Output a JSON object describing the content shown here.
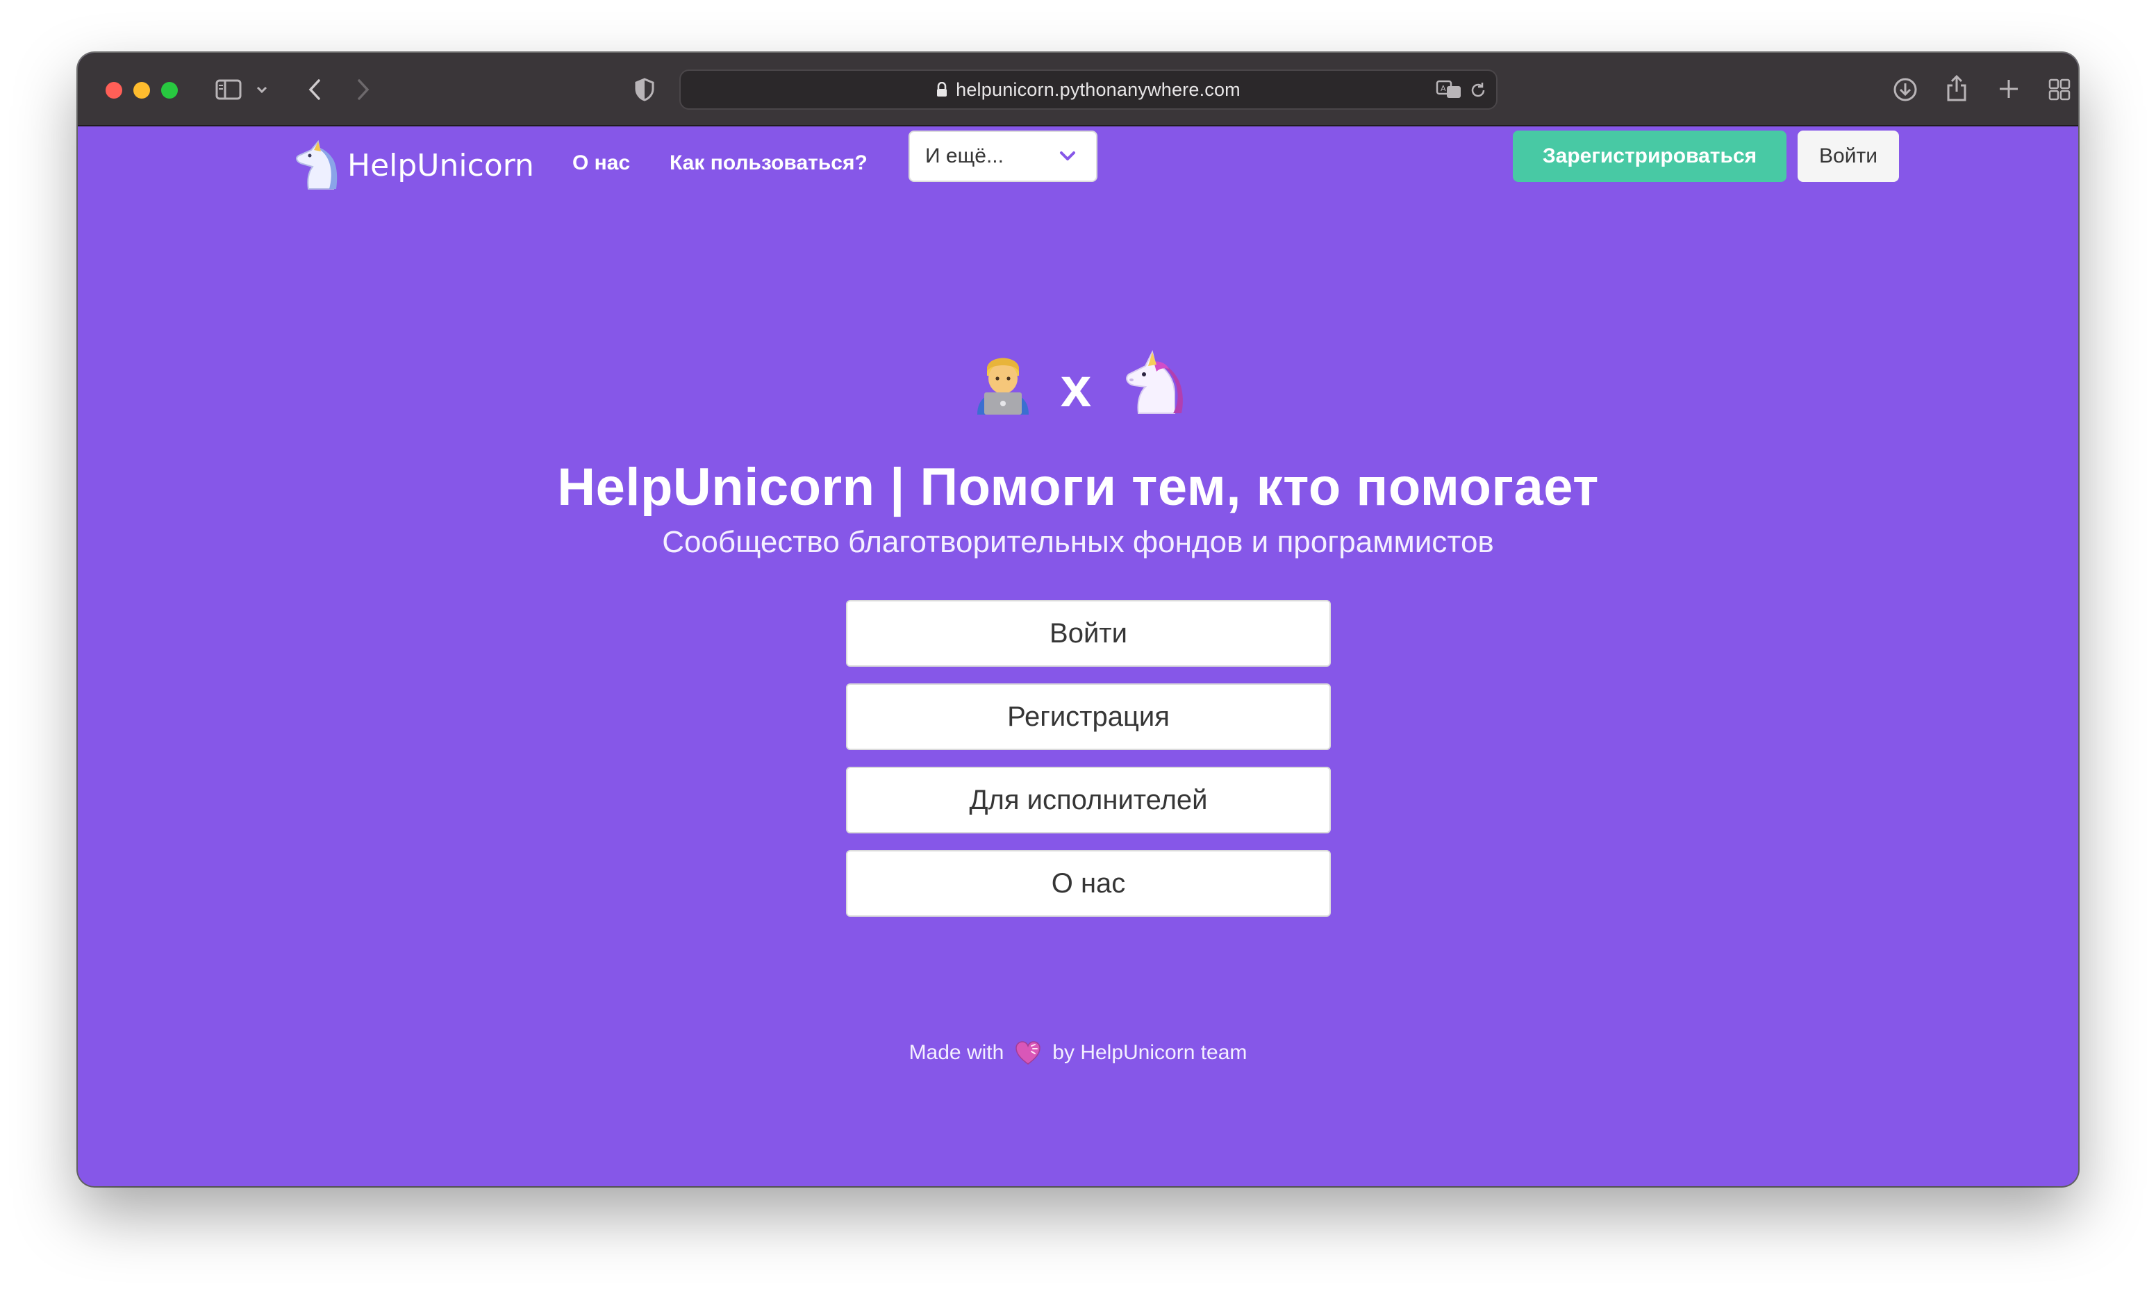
{
  "browser": {
    "url": "helpunicorn.pythonanywhere.com",
    "icons": [
      "sidebar-icon",
      "chevron-down-icon",
      "back-icon",
      "forward-icon",
      "shield-icon",
      "lock-icon",
      "translate-icon",
      "reload-icon",
      "download-icon",
      "share-icon",
      "new-tab-icon",
      "tab-overview-icon"
    ]
  },
  "navbar": {
    "brand": "HelpUnicorn",
    "links": [
      "О нас",
      "Как пользоваться?"
    ],
    "dropdown_label": "И ещё...",
    "register_label": "Зарегистрироваться",
    "login_label": "Войти"
  },
  "hero": {
    "separator": "x",
    "title": "HelpUnicorn | Помоги тем, кто помогает",
    "subtitle": "Сообщество благотворительных фондов и программистов",
    "buttons": [
      "Войти",
      "Регистрация",
      "Для исполнителей",
      "О нас"
    ]
  },
  "footer": {
    "prefix": "Made with",
    "suffix": "by HelpUnicorn team"
  },
  "colors": {
    "background": "#8657e8",
    "accent_green": "#48c9a4",
    "toolbar": "#3a3639"
  }
}
